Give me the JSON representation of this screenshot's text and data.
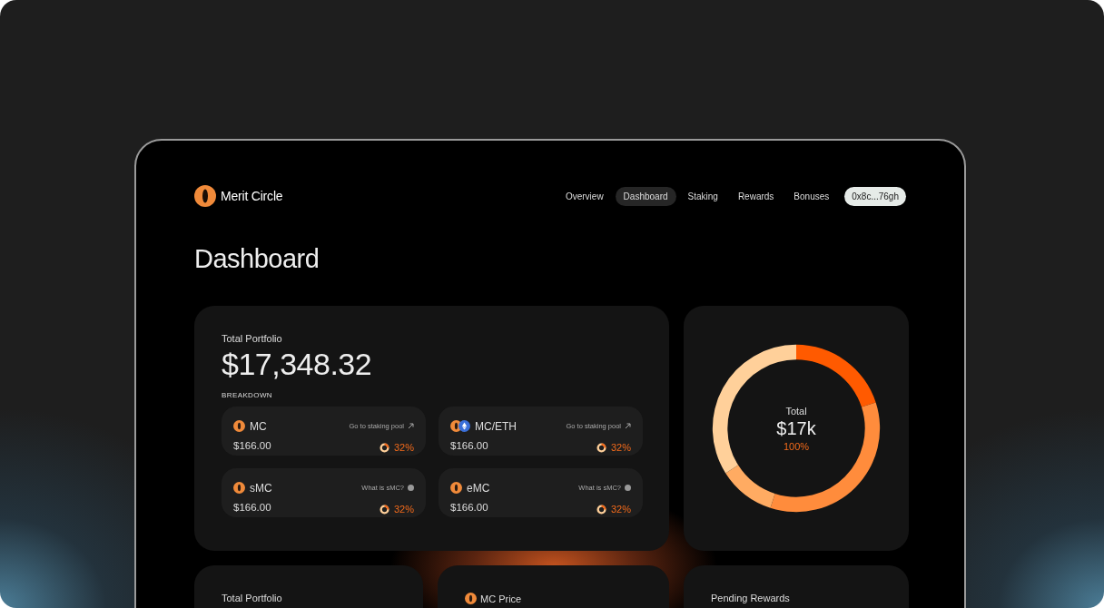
{
  "brand": {
    "name": "Merit Circle"
  },
  "nav": {
    "items": [
      {
        "label": "Overview",
        "selected": false
      },
      {
        "label": "Dashboard",
        "selected": true
      },
      {
        "label": "Staking",
        "selected": false
      },
      {
        "label": "Rewards",
        "selected": false
      },
      {
        "label": "Bonuses",
        "selected": false
      }
    ],
    "wallet": "0x8c...76gh"
  },
  "title": "Dashboard",
  "portfolio": {
    "label": "Total Portfolio",
    "value": "$17,348.32",
    "breakdown_label": "BREAKDOWN",
    "assets": [
      {
        "name": "MC",
        "tokens": [
          {
            "kind": "mc"
          }
        ],
        "value": "$166.00",
        "link": {
          "text": "Go to staking pool",
          "kind": "external"
        },
        "share": "32%"
      },
      {
        "name": "MC/ETH",
        "tokens": [
          {
            "kind": "mc"
          },
          {
            "kind": "eth"
          }
        ],
        "value": "$166.00",
        "link": {
          "text": "Go to staking pool",
          "kind": "external"
        },
        "share": "32%"
      },
      {
        "name": "sMC",
        "tokens": [
          {
            "kind": "mc"
          }
        ],
        "value": "$166.00",
        "link": {
          "text": "What is sMC?",
          "kind": "info"
        },
        "share": "32%"
      },
      {
        "name": "eMC",
        "tokens": [
          {
            "kind": "mc"
          }
        ],
        "value": "$166.00",
        "link": {
          "text": "What is sMC?",
          "kind": "info"
        },
        "share": "32%"
      }
    ]
  },
  "total": {
    "label": "Total",
    "value": "$17k",
    "share": "100%"
  },
  "stats": [
    {
      "label": "Total Portfolio"
    },
    {
      "label": "MC Price",
      "icon": {
        "kind": "mc"
      }
    },
    {
      "label": "Pending Rewards"
    }
  ]
}
